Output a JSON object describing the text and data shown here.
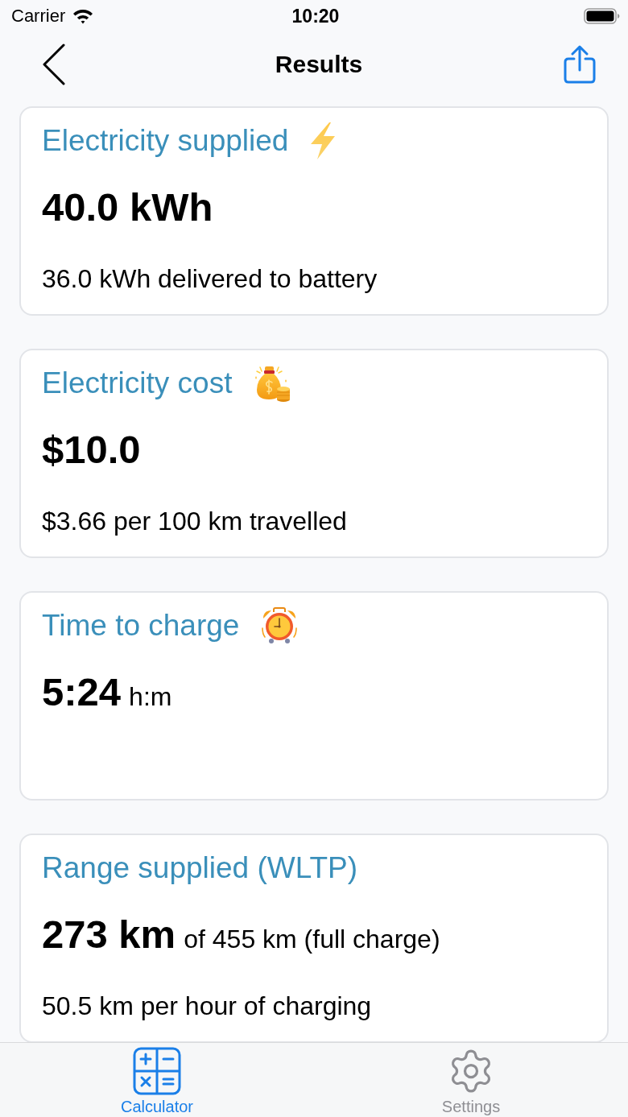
{
  "status_bar": {
    "carrier": "Carrier",
    "time": "10:20"
  },
  "nav_bar": {
    "title": "Results"
  },
  "cards": [
    {
      "title": "Electricity supplied",
      "value": "40.0 kWh",
      "detail": "36.0 kWh delivered to battery"
    },
    {
      "title": "Electricity cost",
      "value": "$10.0",
      "detail": "$3.66 per 100 km travelled"
    },
    {
      "title": "Time to charge",
      "value": "5:24",
      "value_note": "h:m"
    },
    {
      "title": "Range supplied (WLTP)",
      "value": "273 km",
      "value_note": "of 455 km (full charge)",
      "detail": "50.5 km per hour of charging"
    }
  ],
  "tab_bar": {
    "tabs": [
      {
        "label": "Calculator",
        "selected": true
      },
      {
        "label": "Settings",
        "selected": false
      }
    ]
  }
}
